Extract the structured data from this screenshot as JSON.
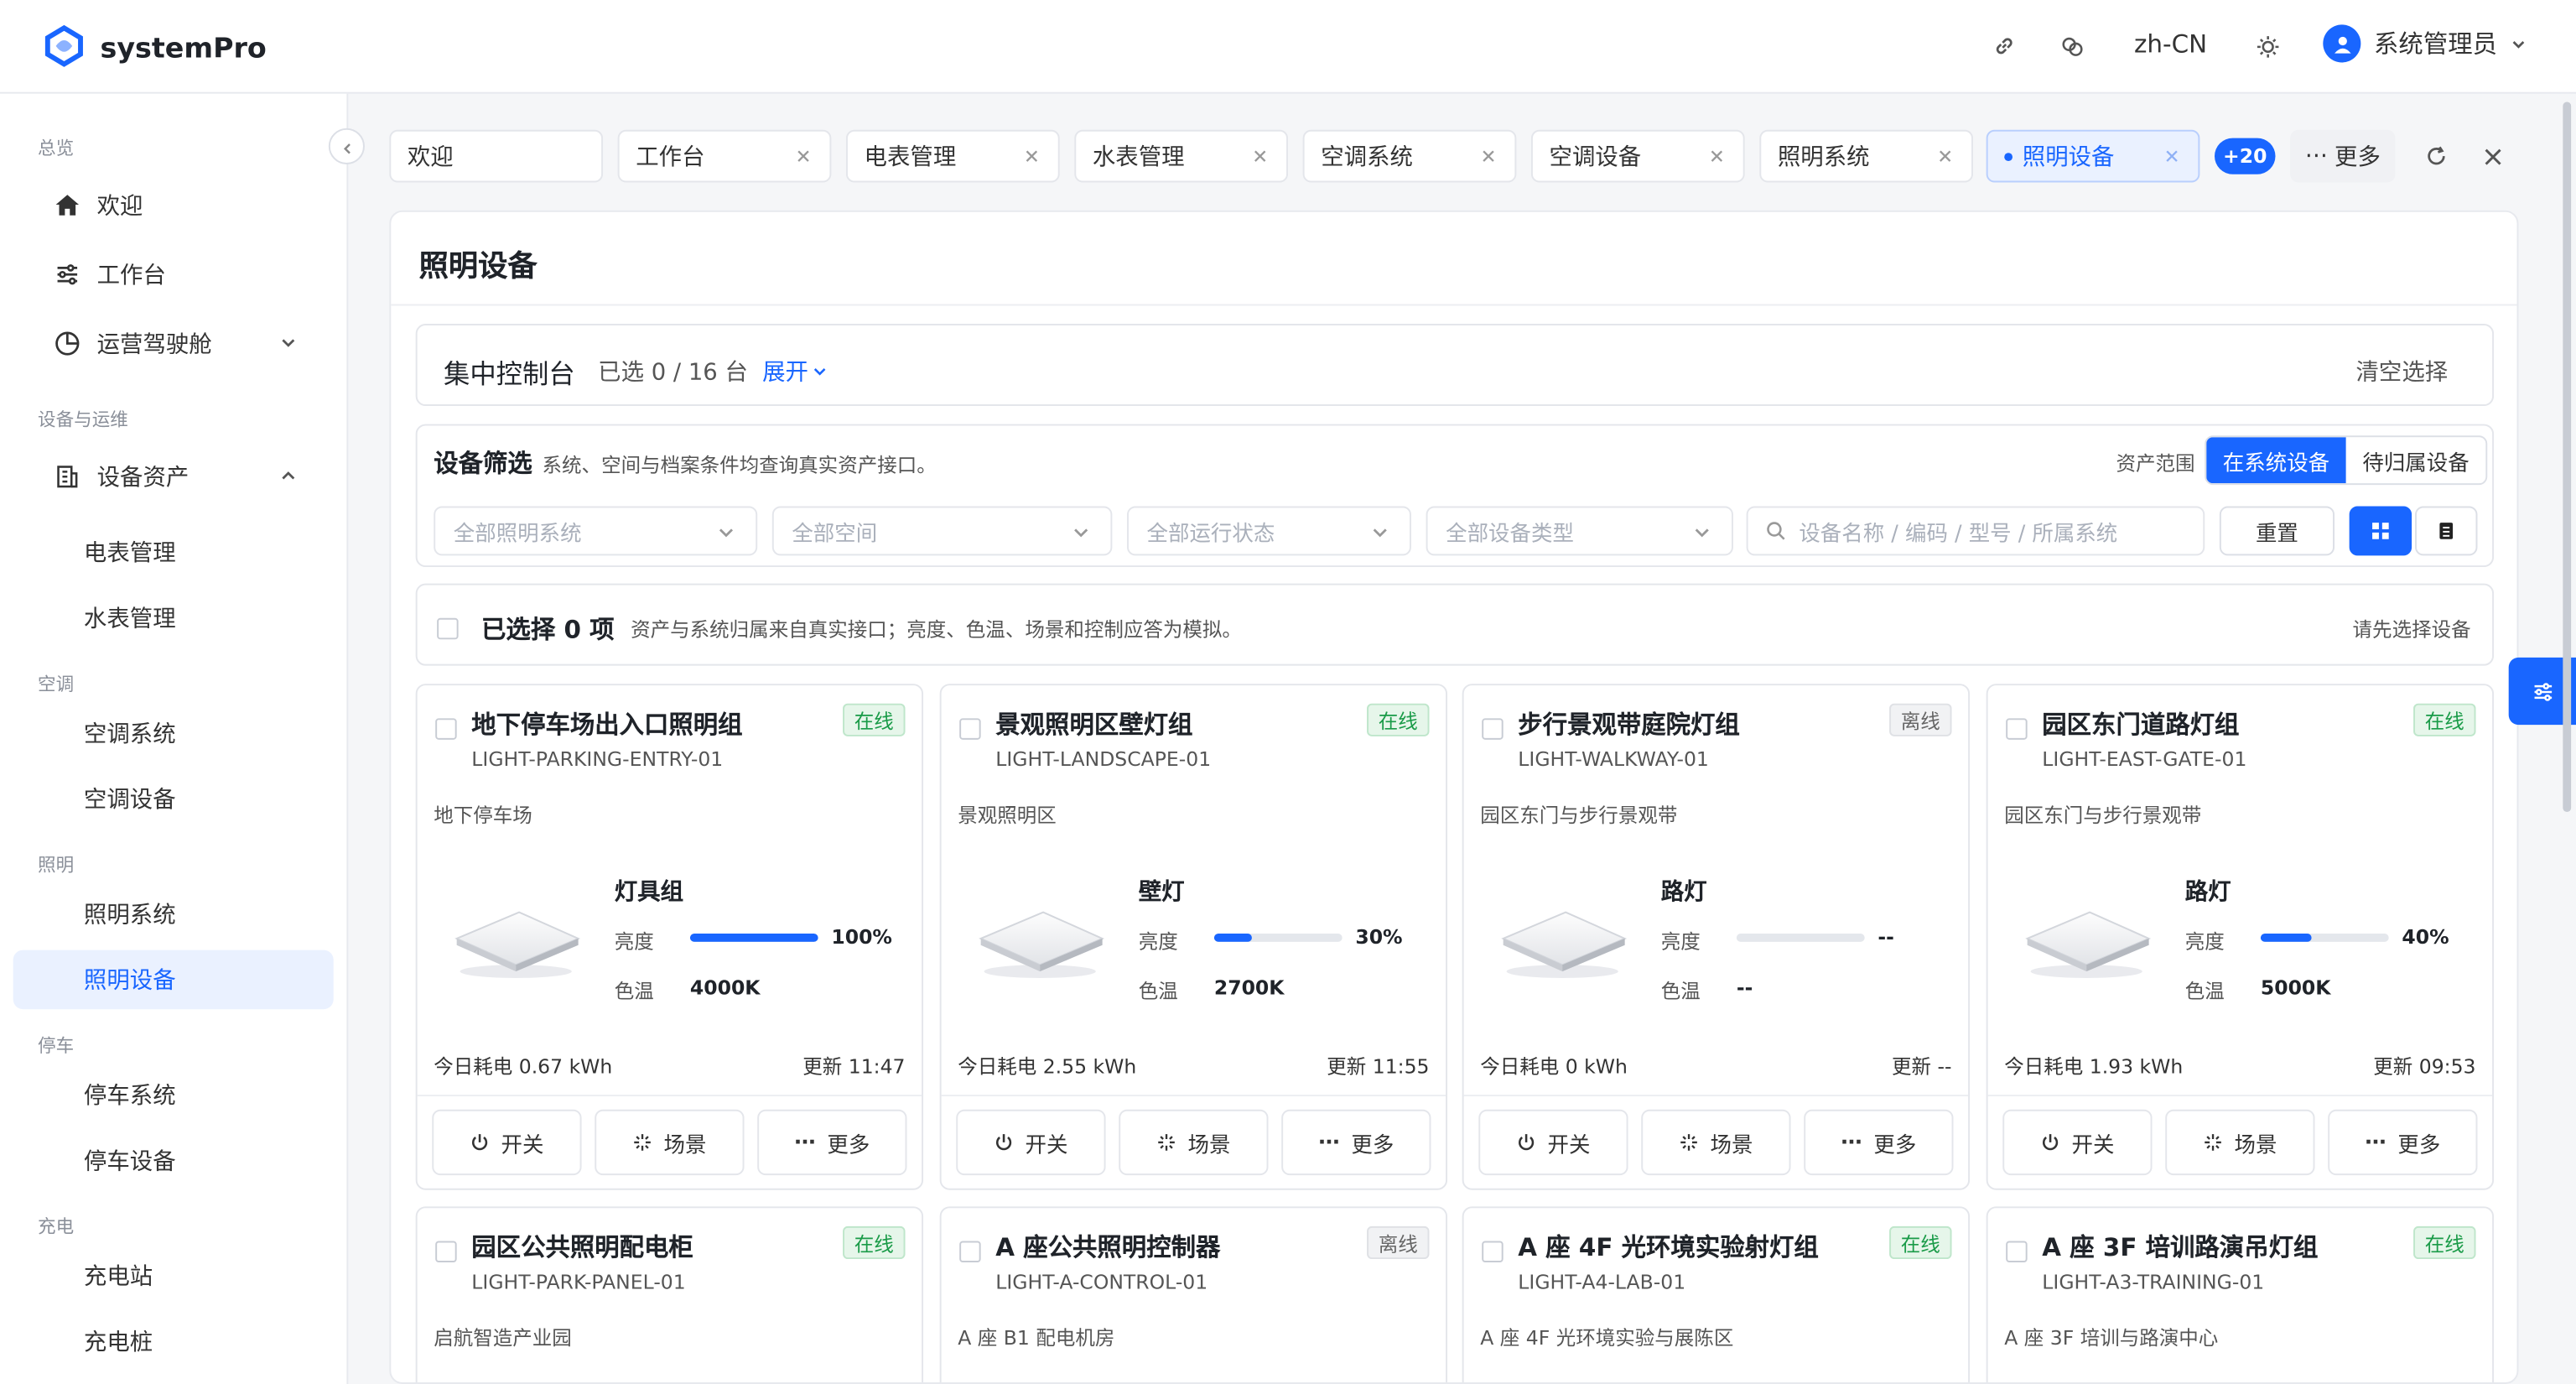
{
  "app": {
    "name": "systemPro"
  },
  "header": {
    "lang": "zh-CN",
    "user": "系统管理员",
    "icons": [
      "link-icon",
      "translate-icon",
      "sun-icon",
      "chevron-down-icon"
    ]
  },
  "sidebar": {
    "groups": [
      {
        "label": "总览",
        "items": [
          {
            "label": "欢迎",
            "icon": "home-icon"
          },
          {
            "label": "工作台",
            "icon": "sliders-icon"
          },
          {
            "label": "运营驾驶舱",
            "icon": "pie-chart-icon"
          }
        ]
      },
      {
        "label": "设备与运维",
        "items": [
          {
            "label": "设备资产",
            "icon": "building-icon"
          },
          {
            "label": "电表管理"
          },
          {
            "label": "水表管理"
          }
        ]
      },
      {
        "label": "空调",
        "items": [
          {
            "label": "空调系统"
          },
          {
            "label": "空调设备"
          }
        ]
      },
      {
        "label": "照明",
        "items": [
          {
            "label": "照明系统"
          },
          {
            "label": "照明设备"
          }
        ]
      },
      {
        "label": "停车",
        "items": [
          {
            "label": "停车系统"
          },
          {
            "label": "停车设备"
          }
        ]
      },
      {
        "label": "充电",
        "items": [
          {
            "label": "充电站"
          },
          {
            "label": "充电桩"
          }
        ]
      }
    ],
    "active": "照明设备"
  },
  "tabs": {
    "items": [
      "欢迎",
      "工作台",
      "电表管理",
      "水表管理",
      "空调系统",
      "空调设备",
      "照明系统",
      "照明设备"
    ],
    "active": "照明设备",
    "extra_count": "+20",
    "more": "更多"
  },
  "page": {
    "title": "照明设备"
  },
  "control": {
    "title": "集中控制台",
    "selected": "已选 0 / 16 台",
    "expand": "展开",
    "clear": "清空选择"
  },
  "filter": {
    "title": "设备筛选",
    "desc": "系统、空间与档案条件均查询真实资产接口。",
    "scope_label": "资产范围",
    "scope_options": [
      "在系统设备",
      "待归属设备"
    ],
    "scope_active": "在系统设备",
    "selects": [
      "全部照明系统",
      "全部空间",
      "全部运行状态",
      "全部设备类型"
    ],
    "search_placeholder": "设备名称 / 编码 / 型号 / 所属系统",
    "reset": "重置"
  },
  "selection": {
    "label": "已选择 0 项",
    "desc": "资产与系统归属来自真实接口；亮度、色温、场景和控制应答为模拟。",
    "hint": "请先选择设备"
  },
  "labels": {
    "brightness": "亮度",
    "color_temp": "色温",
    "switch": "开关",
    "scene": "场景",
    "more": "更多"
  },
  "cards": [
    {
      "name": "地下停车场出入口照明组",
      "code": "LIGHT-PARKING-ENTRY-01",
      "status": "在线",
      "online": true,
      "location": "地下停车场",
      "type": "灯具组",
      "brightness": 100,
      "brightness_text": "100%",
      "color_temp": "4000K",
      "energy": "今日耗电 0.67 kWh",
      "updated": "更新 11:47"
    },
    {
      "name": "景观照明区壁灯组",
      "code": "LIGHT-LANDSCAPE-01",
      "status": "在线",
      "online": true,
      "location": "景观照明区",
      "type": "壁灯",
      "brightness": 30,
      "brightness_text": "30%",
      "color_temp": "2700K",
      "energy": "今日耗电 2.55 kWh",
      "updated": "更新 11:55"
    },
    {
      "name": "步行景观带庭院灯组",
      "code": "LIGHT-WALKWAY-01",
      "status": "离线",
      "online": false,
      "location": "园区东门与步行景观带",
      "type": "路灯",
      "brightness": 0,
      "brightness_text": "--",
      "color_temp": "--",
      "energy": "今日耗电 0 kWh",
      "updated": "更新 --"
    },
    {
      "name": "园区东门道路灯组",
      "code": "LIGHT-EAST-GATE-01",
      "status": "在线",
      "online": true,
      "location": "园区东门与步行景观带",
      "type": "路灯",
      "brightness": 40,
      "brightness_text": "40%",
      "color_temp": "5000K",
      "energy": "今日耗电 1.93 kWh",
      "updated": "更新 09:53"
    },
    {
      "name": "园区公共照明配电柜",
      "code": "LIGHT-PARK-PANEL-01",
      "status": "在线",
      "online": true,
      "location": "启航智造产业园"
    },
    {
      "name": "A 座公共照明控制器",
      "code": "LIGHT-A-CONTROL-01",
      "status": "离线",
      "online": false,
      "location": "A 座 B1 配电机房"
    },
    {
      "name": "A 座 4F 光环境实验射灯组",
      "code": "LIGHT-A4-LAB-01",
      "status": "在线",
      "online": true,
      "location": "A 座 4F 光环境实验与展陈区"
    },
    {
      "name": "A 座 3F 培训路演吊灯组",
      "code": "LIGHT-A3-TRAINING-01",
      "status": "在线",
      "online": true,
      "location": "A 座 3F 培训与路演中心"
    }
  ]
}
